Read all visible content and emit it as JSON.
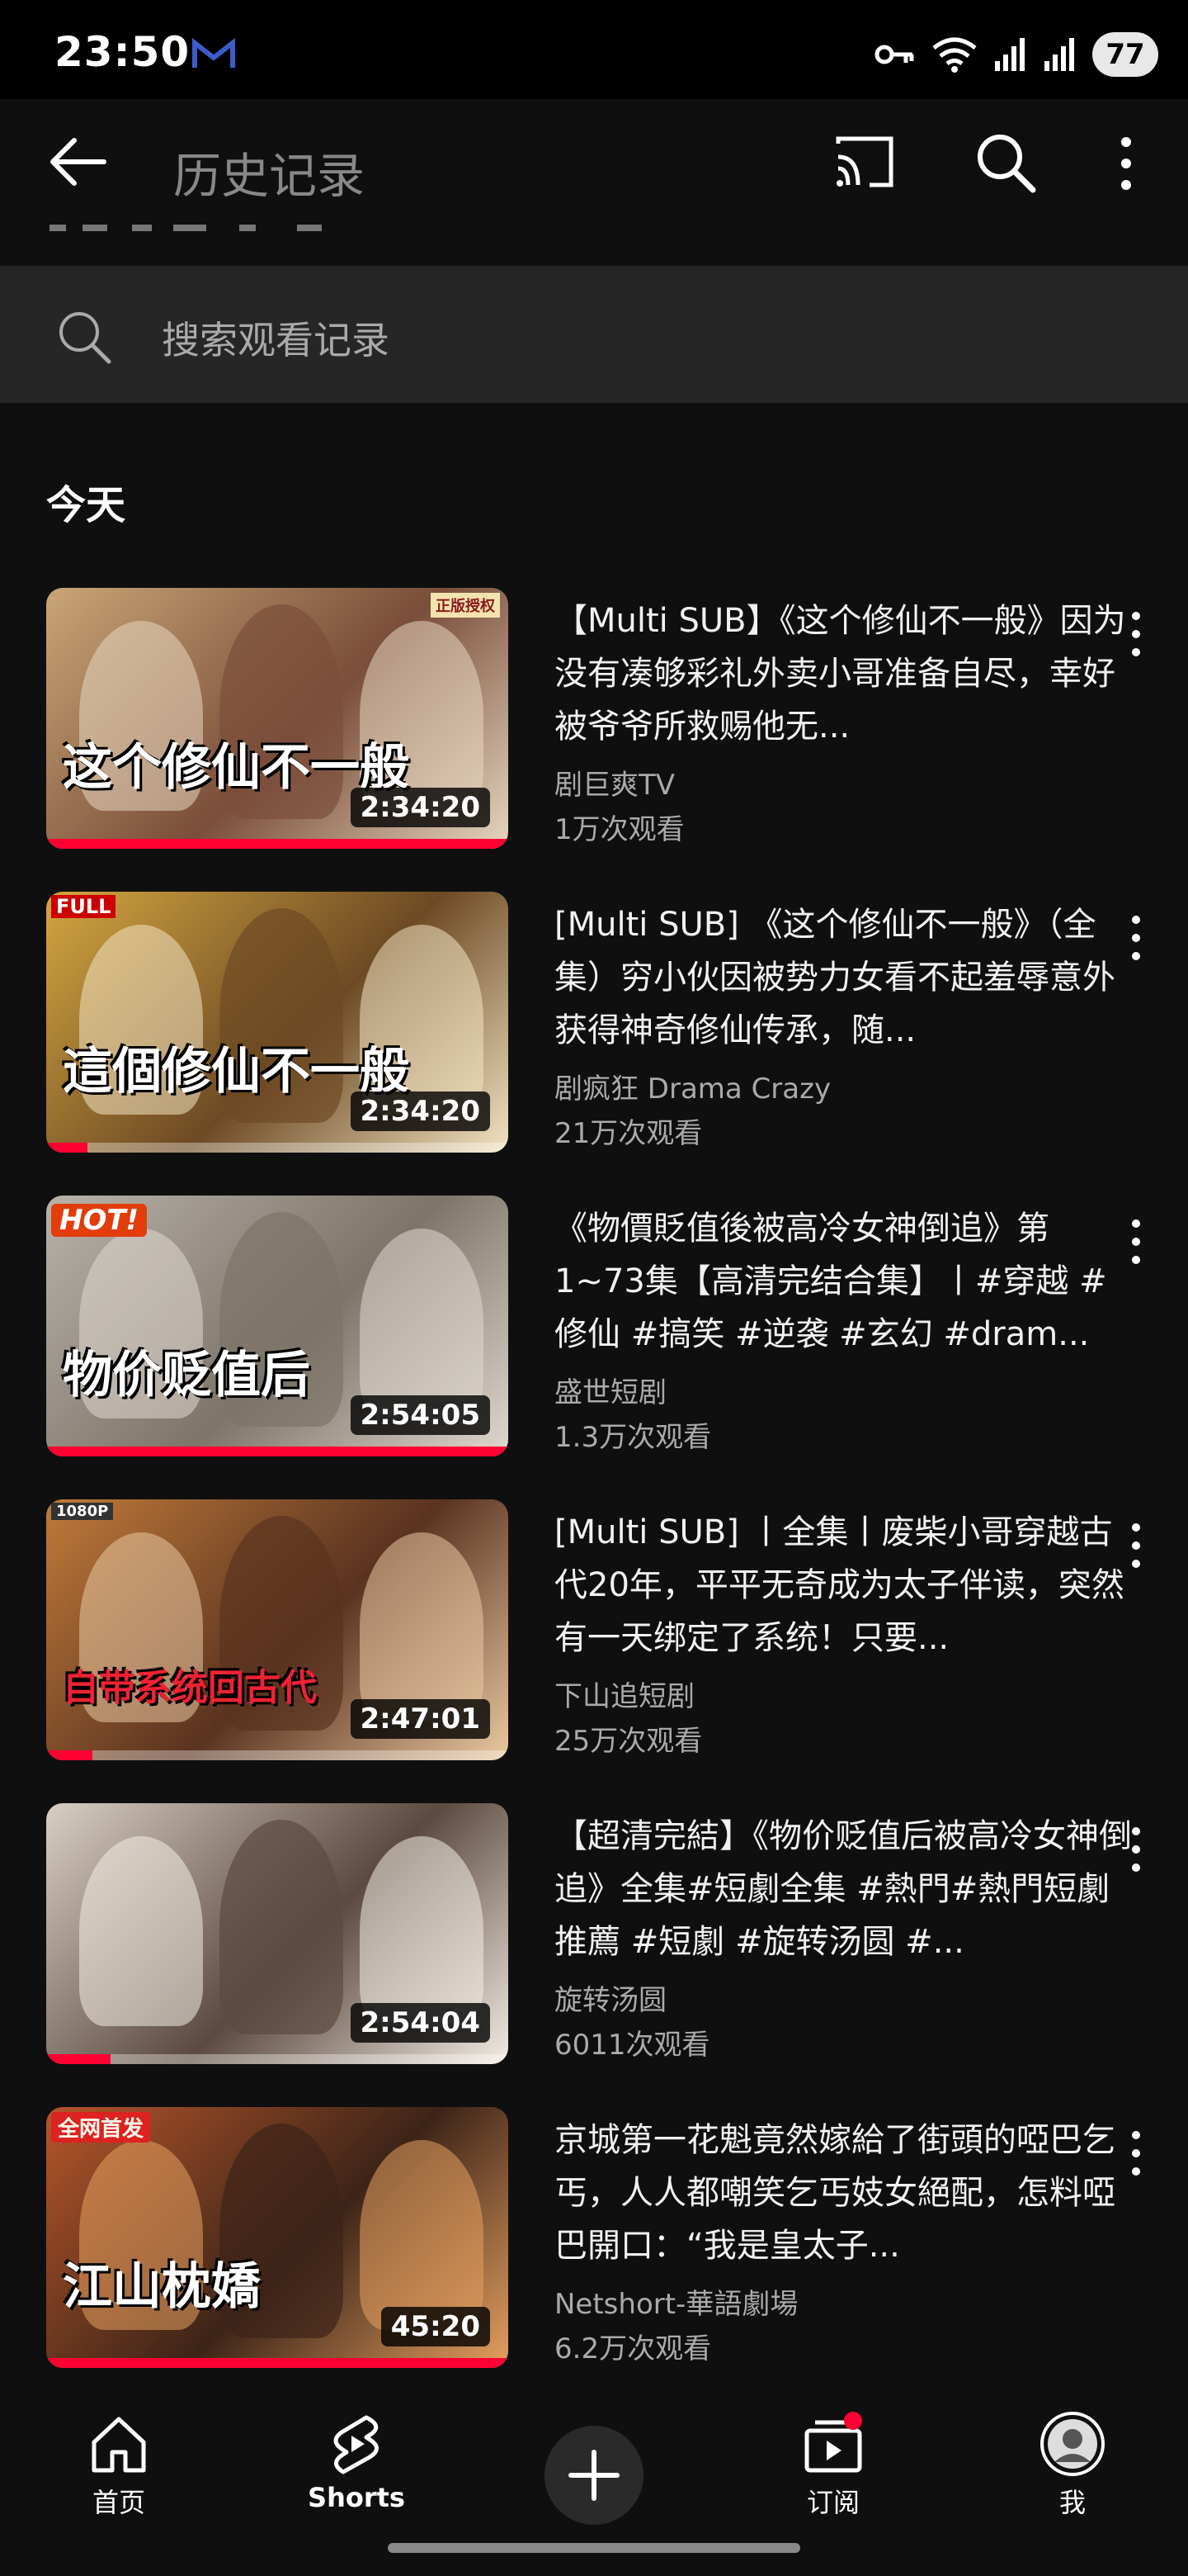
{
  "status_bar": {
    "time": "23:50",
    "battery": "77"
  },
  "app_bar": {
    "title": "历史记录"
  },
  "search": {
    "placeholder": "搜索观看记录"
  },
  "section": {
    "title": "今天"
  },
  "videos": [
    {
      "title": "【Multi SUB】《这个修仙不一般》因为没有凑够彩礼外卖小哥准备自尽，幸好被爷爷所救赐他无...",
      "channel": "剧巨爽TV",
      "views": "1万次观看",
      "duration": "2:34:20",
      "progress": 1.0,
      "thumb_caption": "这个修仙不一般",
      "badge": "正版授权",
      "colors": [
        "#c9a676",
        "#7a4e3a",
        "#e7d7c1"
      ]
    },
    {
      "title": "[Multi SUB] 《这个修仙不一般》（全集）穷小伙因被势力女看不起羞辱意外获得神奇修仙传承，随...",
      "channel": "剧疯狂 Drama Crazy",
      "views": "21万次观看",
      "duration": "2:34:20",
      "progress": 0.09,
      "thumb_caption": "這個修仙不一般",
      "badge": "FULL",
      "colors": [
        "#d4a640",
        "#6d4a24",
        "#f2e3c2"
      ]
    },
    {
      "title": "《物價貶值後被高冷女神倒追》第1~73集【高清完结合集】丨#穿越 #修仙 #搞笑 #逆袭 #玄幻 #dram...",
      "channel": "盛世短剧",
      "views": "1.3万次观看",
      "duration": "2:54:05",
      "progress": 1.0,
      "thumb_caption": "物价贬值后",
      "badge": "HOT!",
      "colors": [
        "#b8b2a8",
        "#7e746a",
        "#e0d9cf"
      ]
    },
    {
      "title": "[Multi SUB] 丨全集丨废柴小哥穿越古代20年，平平无奇成为太子伴读，突然有一天绑定了系统！只要...",
      "channel": "下山追短剧",
      "views": "25万次观看",
      "duration": "2:47:01",
      "progress": 0.1,
      "thumb_caption": "自带系统回古代",
      "badge": "1080P",
      "colors": [
        "#c07a3a",
        "#5a3320",
        "#e9c9a2"
      ]
    },
    {
      "title": "【超清完結】《物价贬值后被高冷女神倒追》全集#短劇全集 #熱門#熱門短劇推薦 #短劇 #旋转汤圆 #...",
      "channel": "旋转汤圆",
      "views": "6011次观看",
      "duration": "2:54:04",
      "progress": 0.14,
      "thumb_caption": "",
      "badge": "",
      "colors": [
        "#d9cfc4",
        "#5c4a40",
        "#f3ece4"
      ]
    },
    {
      "title": "京城第一花魁竟然嫁給了街頭的啞巴乞丐，人人都嘲笑乞丐妓女絕配，怎料啞巴開口：“我是皇太子...",
      "channel": "Netshort-華語劇場",
      "views": "6.2万次观看",
      "duration": "45:20",
      "progress": 1.0,
      "thumb_caption": "江山枕嬌",
      "badge": "全网首发",
      "colors": [
        "#b5562a",
        "#3d2418",
        "#e5a060"
      ]
    }
  ],
  "bottom_nav": {
    "home": "首页",
    "shorts": "Shorts",
    "subscriptions": "订阅",
    "you": "我"
  },
  "colors": {
    "accent": "#ff0033",
    "background": "#0f0f0f",
    "search_bg": "#262626"
  }
}
